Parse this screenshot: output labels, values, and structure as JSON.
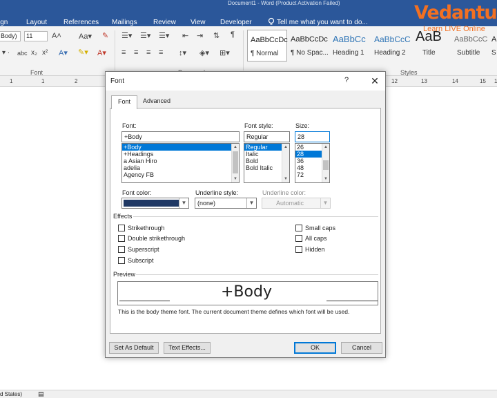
{
  "titlebar": {
    "text": "Document1 - Word (Product Activation Failed)"
  },
  "ribbon_tabs": [
    "ign",
    "Layout",
    "References",
    "Mailings",
    "Review",
    "View",
    "Developer"
  ],
  "tell_me": "Tell me what you want to do...",
  "ribbon": {
    "font_name": "Body)",
    "font_size": "11",
    "group_font": "Font",
    "group_paragraph": "Paragraph",
    "group_styles": "Styles",
    "styles": [
      {
        "sample": "AaBbCcDc",
        "name": "¶ Normal"
      },
      {
        "sample": "AaBbCcDc",
        "name": "¶ No Spac..."
      },
      {
        "sample": "AaBbCc",
        "name": "Heading 1"
      },
      {
        "sample": "AaBbCcC",
        "name": "Heading 2"
      },
      {
        "sample": "AaB",
        "name": "Title"
      },
      {
        "sample": "AaBbCcC",
        "name": "Subtitle"
      },
      {
        "sample": "A",
        "name": "S"
      }
    ]
  },
  "ruler": {
    "left_nums": [
      "1",
      "1",
      "2"
    ],
    "right_nums": [
      "12",
      "13",
      "14",
      "15",
      "16"
    ]
  },
  "status": {
    "left": "d States)"
  },
  "watermark": {
    "brand": "Vedantu",
    "tagline": "Learn LIVE Online"
  },
  "dialog": {
    "title": "Font",
    "help": "?",
    "close": "✕",
    "tabs": [
      "Font",
      "Advanced"
    ],
    "font_label": "Font:",
    "font_value": "+Body",
    "font_list": [
      "+Body",
      "+Headings",
      "a Asian Hiro",
      "adelia",
      "Agency FB"
    ],
    "style_label": "Font style:",
    "style_value": "Regular",
    "style_list": [
      "Regular",
      "Italic",
      "Bold",
      "Bold Italic"
    ],
    "size_label": "Size:",
    "size_value": "28",
    "size_list": [
      "26",
      "28",
      "36",
      "48",
      "72"
    ],
    "color_label": "Font color:",
    "underline_style_label": "Underline style:",
    "underline_style_value": "(none)",
    "underline_color_label": "Underline color:",
    "underline_color_value": "Automatic",
    "effects_label": "Effects",
    "effects_left": [
      "Strikethrough",
      "Double strikethrough",
      "Superscript",
      "Subscript"
    ],
    "effects_right": [
      "Small caps",
      "All caps",
      "Hidden"
    ],
    "preview_label": "Preview",
    "preview_text": "+Body",
    "description": "This is the body theme font. The current document theme defines which font will be used.",
    "buttons": {
      "set_default": "Set As Default",
      "text_effects": "Text Effects...",
      "ok": "OK",
      "cancel": "Cancel"
    }
  },
  "colors": {
    "accent": "#2b579a",
    "font_color_swatch": "#1f3864",
    "selection": "#0078d7",
    "watermark": "#f37021"
  }
}
